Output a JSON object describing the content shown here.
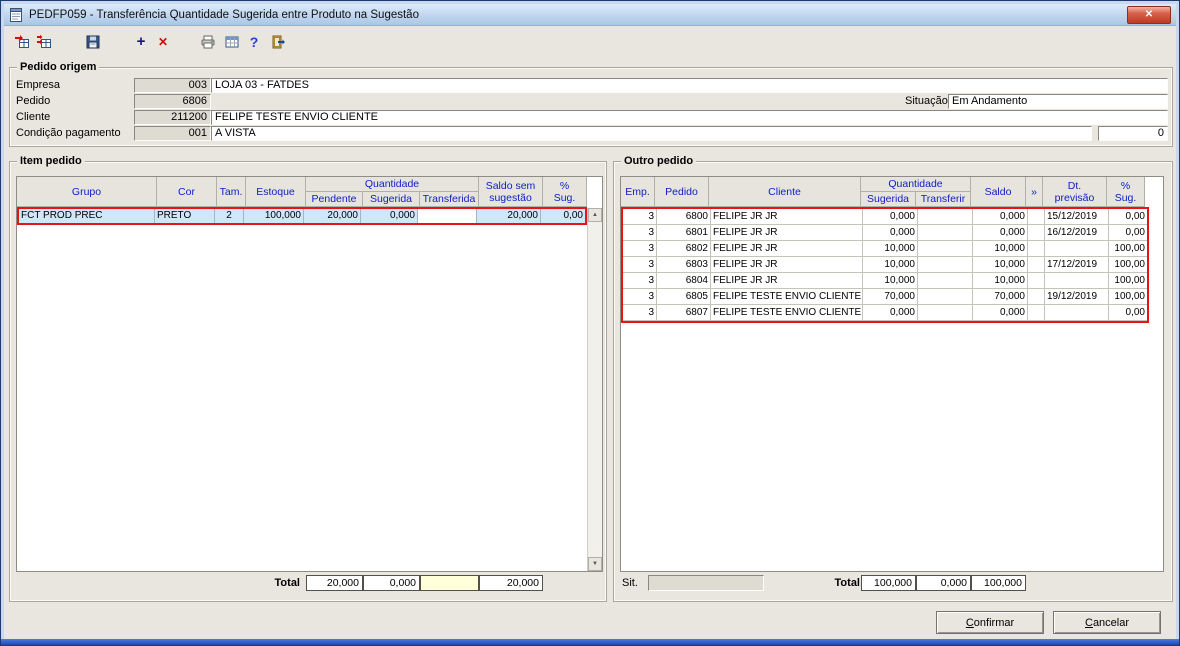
{
  "window": {
    "title": "PEDFP059 - Transferência Quantidade Sugerida entre Produto na Sugestão",
    "close_glyph": "✕"
  },
  "toolbar": {
    "add_glyph": "+",
    "delete_glyph": "✕",
    "help_glyph": "?"
  },
  "pedido_origem": {
    "title": "Pedido origem",
    "empresa_label": "Empresa",
    "empresa_code": "003",
    "empresa_name": "LOJA 03 - FATDES",
    "pedido_label": "Pedido",
    "pedido_code": "6806",
    "situacao_label": "Situação",
    "situacao_value": "Em Andamento",
    "cliente_label": "Cliente",
    "cliente_code": "211200",
    "cliente_name": "FELIPE TESTE ENVIO CLIENTE",
    "condicao_label": "Condição pagamento",
    "condicao_code": "001",
    "condicao_value": "A VISTA",
    "condicao_extra": "0"
  },
  "item_pedido": {
    "title": "Item pedido",
    "headers": {
      "grupo": "Grupo",
      "cor": "Cor",
      "tam": "Tam.",
      "estoque": "Estoque",
      "quantidade": "Quantidade",
      "pendente": "Pendente",
      "sugerida": "Sugerida",
      "transferida": "Transferida",
      "saldo_l1": "Saldo sem",
      "saldo_l2": "sugestão",
      "psug_l1": "%",
      "psug_l2": "Sug."
    },
    "rows": [
      {
        "grupo": "FCT PROD PREC",
        "cor": "PRETO",
        "tam": "2",
        "estoque": "100,000",
        "pendente": "20,000",
        "sugerida": "0,000",
        "transferida": "",
        "saldo": "20,000",
        "psug": "0,00"
      }
    ],
    "total_label": "Total",
    "totals": {
      "pendente": "20,000",
      "sugerida": "0,000",
      "transferida": "",
      "saldo": "20,000"
    }
  },
  "outro_pedido": {
    "title": "Outro pedido",
    "headers": {
      "emp": "Emp.",
      "pedido": "Pedido",
      "cliente": "Cliente",
      "quantidade": "Quantidade",
      "sugerida": "Sugerida",
      "transferir": "Transferir",
      "saldo": "Saldo",
      "expand": "»",
      "dt_l1": "Dt.",
      "dt_l2": "previsão",
      "psug_l1": "%",
      "psug_l2": "Sug."
    },
    "rows": [
      {
        "emp": "3",
        "pedido": "6800",
        "cliente": "FELIPE JR JR",
        "sugerida": "0,000",
        "transferir": "",
        "saldo": "0,000",
        "dt": "15/12/2019",
        "psug": "0,00"
      },
      {
        "emp": "3",
        "pedido": "6801",
        "cliente": "FELIPE JR JR",
        "sugerida": "0,000",
        "transferir": "",
        "saldo": "0,000",
        "dt": "16/12/2019",
        "psug": "0,00"
      },
      {
        "emp": "3",
        "pedido": "6802",
        "cliente": "FELIPE JR JR",
        "sugerida": "10,000",
        "transferir": "",
        "saldo": "10,000",
        "dt": "",
        "psug": "100,00"
      },
      {
        "emp": "3",
        "pedido": "6803",
        "cliente": "FELIPE JR JR",
        "sugerida": "10,000",
        "transferir": "",
        "saldo": "10,000",
        "dt": "17/12/2019",
        "psug": "100,00"
      },
      {
        "emp": "3",
        "pedido": "6804",
        "cliente": "FELIPE JR JR",
        "sugerida": "10,000",
        "transferir": "",
        "saldo": "10,000",
        "dt": "",
        "psug": "100,00"
      },
      {
        "emp": "3",
        "pedido": "6805",
        "cliente": "FELIPE TESTE ENVIO CLIENTE",
        "sugerida": "70,000",
        "transferir": "",
        "saldo": "70,000",
        "dt": "19/12/2019",
        "psug": "100,00"
      },
      {
        "emp": "3",
        "pedido": "6807",
        "cliente": "FELIPE TESTE ENVIO CLIENTE",
        "sugerida": "0,000",
        "transferir": "",
        "saldo": "0,000",
        "dt": "",
        "psug": "0,00"
      }
    ],
    "sit_label": "Sit.",
    "sit_value": "",
    "total_label": "Total",
    "totals": {
      "sugerida": "100,000",
      "transferir": "0,000",
      "saldo": "100,000"
    }
  },
  "buttons": {
    "confirmar": "Confirmar",
    "cancelar": "Cancelar"
  },
  "ui": {
    "scroll_up": "▲",
    "scroll_down": "▼"
  },
  "colors": {
    "highlight_border": "#e81414",
    "selected_row_bg": "#cfe7f9",
    "header_text": "#0a1ec4",
    "titlebar_top": "#dcebfb",
    "titlebar_bottom": "#aac6e6",
    "bottom_strip": "#1c49b4",
    "editable_field": "#ffffd9"
  }
}
